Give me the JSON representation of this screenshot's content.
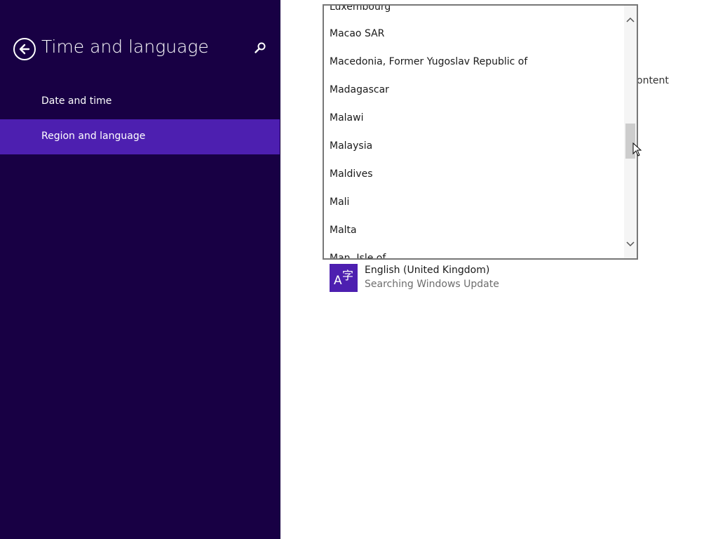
{
  "nav": {
    "title": "Time and language",
    "items": [
      {
        "label": "Date and time",
        "selected": false
      },
      {
        "label": "Region and language",
        "selected": true
      }
    ]
  },
  "country_list": {
    "items": [
      "Luxembourg",
      "Macao SAR",
      "Macedonia, Former Yugoslav Republic of",
      "Madagascar",
      "Malawi",
      "Malaysia",
      "Maldives",
      "Mali",
      "Malta",
      "Man, Isle of"
    ]
  },
  "background_text": {
    "partial": "ontent"
  },
  "language": {
    "name": "English (United Kingdom)",
    "status": "Searching Windows Update",
    "icon": "language-icon"
  },
  "icons": {
    "back": "back-arrow-icon",
    "search": "search-icon",
    "scroll_up": "chevron-up-icon",
    "scroll_down": "chevron-down-icon"
  },
  "colors": {
    "nav_background": "#180044",
    "accent": "#4d1fb0",
    "content_background": "#ffffff"
  }
}
